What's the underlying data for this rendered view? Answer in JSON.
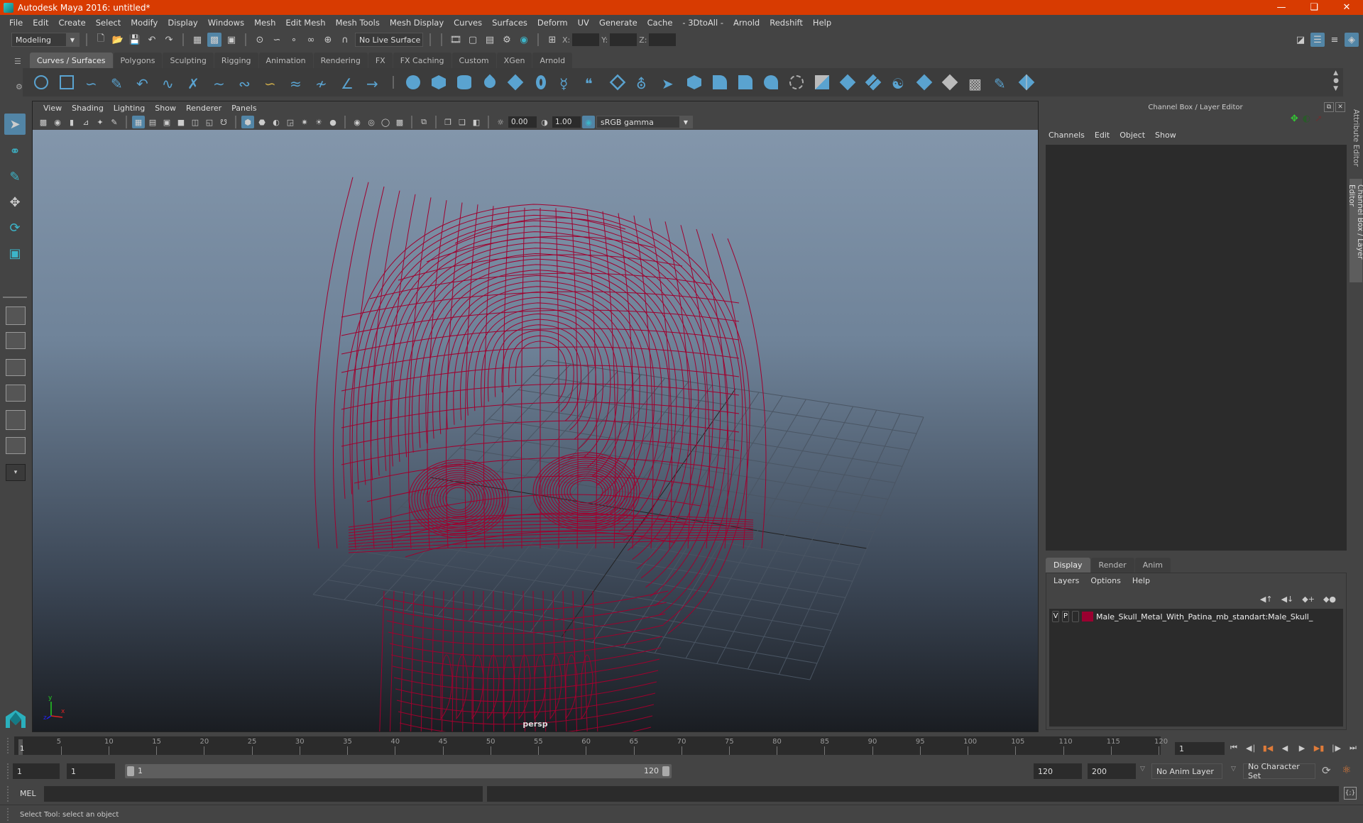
{
  "window": {
    "title": "Autodesk Maya 2016: untitled*",
    "controls": [
      "minimize",
      "restore",
      "close"
    ]
  },
  "menubar": [
    "File",
    "Edit",
    "Create",
    "Select",
    "Modify",
    "Display",
    "Windows",
    "Mesh",
    "Edit Mesh",
    "Mesh Tools",
    "Mesh Display",
    "Curves",
    "Surfaces",
    "Deform",
    "UV",
    "Generate",
    "Cache",
    "- 3DtoAll -",
    "Arnold",
    "Redshift",
    "Help"
  ],
  "statusline": {
    "menuset": "Modeling",
    "live_surface": "No Live Surface",
    "x_label": "X:",
    "y_label": "Y:",
    "z_label": "Z:",
    "x_value": "",
    "y_value": "",
    "z_value": ""
  },
  "shelf": {
    "tabs": [
      "Curves / Surfaces",
      "Polygons",
      "Sculpting",
      "Rigging",
      "Animation",
      "Rendering",
      "FX",
      "FX Caching",
      "Custom",
      "XGen",
      "Arnold"
    ],
    "active_tab": "Curves / Surfaces"
  },
  "viewport": {
    "menus": [
      "View",
      "Shading",
      "Lighting",
      "Show",
      "Renderer",
      "Panels"
    ],
    "exposure": "0.00",
    "gamma": "1.00",
    "color_space": "sRGB gamma",
    "camera_label": "persp",
    "axis_labels": {
      "x": "x",
      "y": "y",
      "z": "z"
    },
    "wireframe_color": "#a0002e"
  },
  "channel_box": {
    "title": "Channel Box / Layer Editor",
    "menus": [
      "Channels",
      "Edit",
      "Object",
      "Show"
    ]
  },
  "layer_editor": {
    "tabs": [
      "Display",
      "Render",
      "Anim"
    ],
    "active_tab": "Display",
    "menus": [
      "Layers",
      "Options",
      "Help"
    ],
    "layers": [
      {
        "visible": "V",
        "playback": "P",
        "color": "#9a0030",
        "name": "Male_Skull_Metal_With_Patina_mb_standart:Male_Skull_"
      }
    ]
  },
  "side_tabs": [
    "Attribute Editor",
    "Channel Box / Layer Editor"
  ],
  "time_slider": {
    "start": 1,
    "end": 120,
    "labels": [
      "5",
      "10",
      "15",
      "20",
      "25",
      "30",
      "35",
      "40",
      "45",
      "50",
      "55",
      "60",
      "65",
      "70",
      "75",
      "80",
      "85",
      "90",
      "95",
      "100",
      "105",
      "110",
      "115",
      "120"
    ],
    "current_frame_marker": "1",
    "current_frame": "1"
  },
  "range_slider": {
    "start_time": "1",
    "playback_start": "1",
    "range_start_label": "1",
    "range_end_label": "120",
    "playback_end": "120",
    "end_time": "200",
    "anim_layer": "No Anim Layer",
    "character_set": "No Character Set"
  },
  "command_line": {
    "label": "MEL",
    "input": "",
    "result": ""
  },
  "status": {
    "help_line": "Select Tool: select an object"
  }
}
